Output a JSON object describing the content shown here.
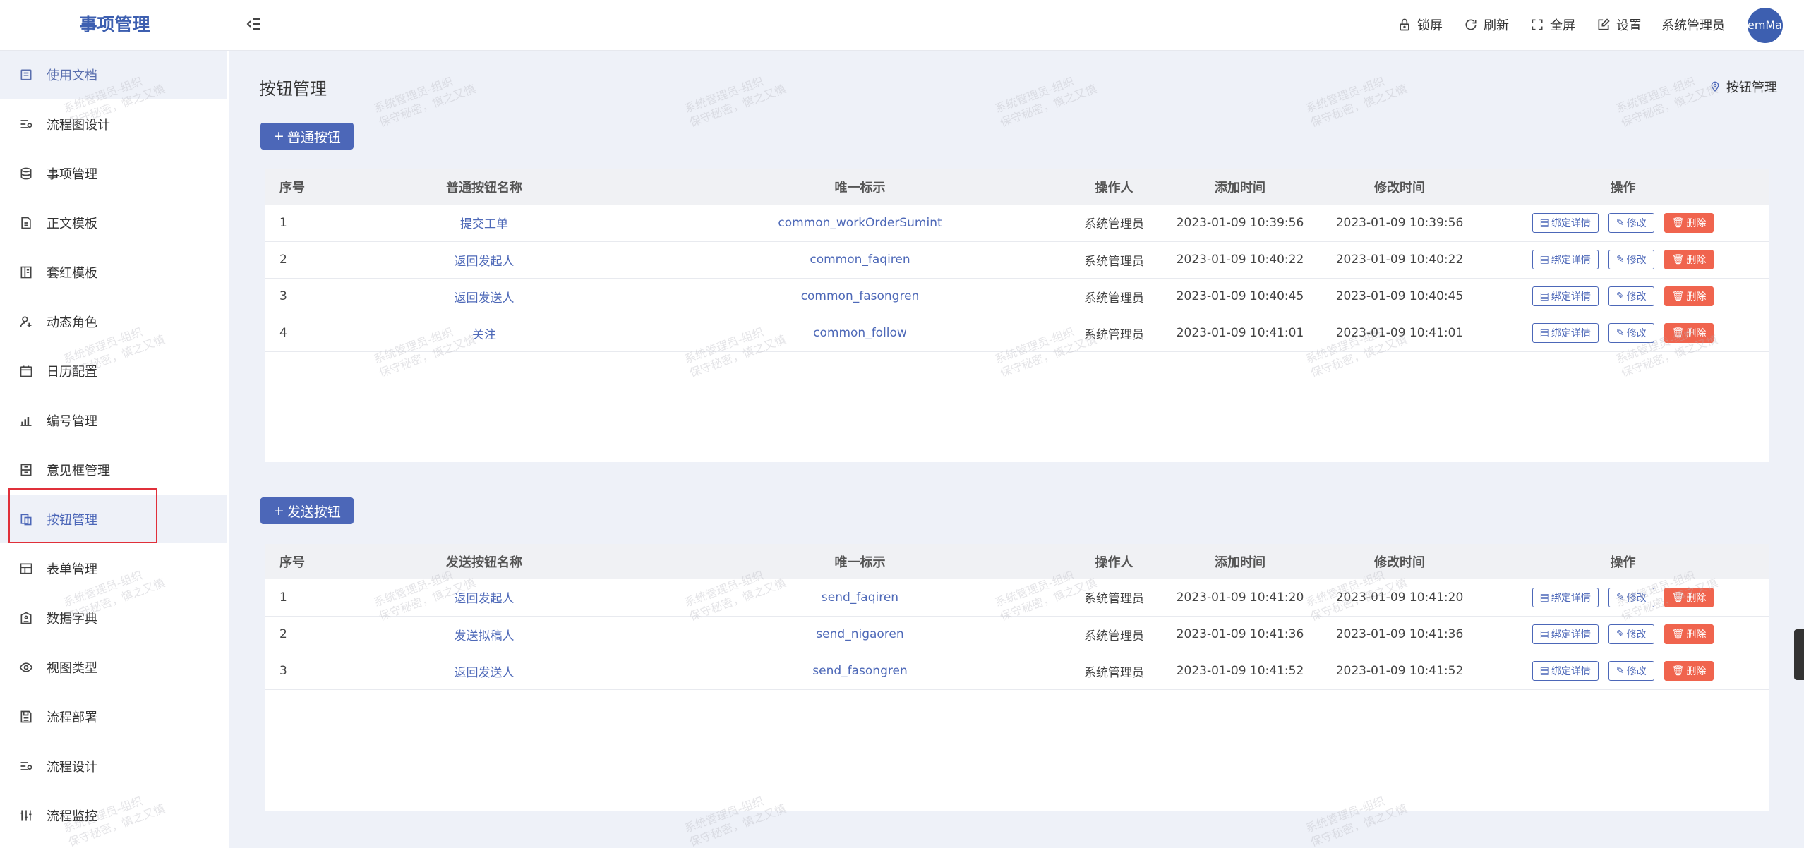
{
  "header": {
    "app_title": "事项管理",
    "lock": "锁屏",
    "refresh": "刷新",
    "fullscreen": "全屏",
    "settings": "设置",
    "user": "系统管理员",
    "avatar_text": "emMan"
  },
  "sidebar": {
    "items": [
      {
        "label": "使用文档",
        "icon": "document-icon"
      },
      {
        "label": "流程图设计",
        "icon": "flow-design-icon"
      },
      {
        "label": "事项管理",
        "icon": "database-icon"
      },
      {
        "label": "正文模板",
        "icon": "template-icon"
      },
      {
        "label": "套红模板",
        "icon": "red-template-icon"
      },
      {
        "label": "动态角色",
        "icon": "user-add-icon"
      },
      {
        "label": "日历配置",
        "icon": "calendar-icon"
      },
      {
        "label": "编号管理",
        "icon": "bar-chart-icon"
      },
      {
        "label": "意见框管理",
        "icon": "form-box-icon"
      },
      {
        "label": "按钮管理",
        "icon": "copy-icon"
      },
      {
        "label": "表单管理",
        "icon": "table-icon"
      },
      {
        "label": "数据字典",
        "icon": "dictionary-icon"
      },
      {
        "label": "视图类型",
        "icon": "eye-icon"
      },
      {
        "label": "流程部署",
        "icon": "save-icon"
      },
      {
        "label": "流程设计",
        "icon": "flow-icon"
      },
      {
        "label": "流程监控",
        "icon": "sliders-icon"
      }
    ]
  },
  "main": {
    "page_title": "按钮管理",
    "breadcrumb": "按钮管理",
    "common_add_label": "普通按钮",
    "send_add_label": "发送按钮",
    "common_table": {
      "headers": [
        "序号",
        "普通按钮名称",
        "唯一标示",
        "操作人",
        "添加时间",
        "修改时间",
        "操作"
      ],
      "rows": [
        {
          "idx": "1",
          "name": "提交工单",
          "key": "common_workOrderSumint",
          "operator": "系统管理员",
          "added": "2023-01-09 10:39:56",
          "modified": "2023-01-09 10:39:56"
        },
        {
          "idx": "2",
          "name": "返回发起人",
          "key": "common_faqiren",
          "operator": "系统管理员",
          "added": "2023-01-09 10:40:22",
          "modified": "2023-01-09 10:40:22"
        },
        {
          "idx": "3",
          "name": "返回发送人",
          "key": "common_fasongren",
          "operator": "系统管理员",
          "added": "2023-01-09 10:40:45",
          "modified": "2023-01-09 10:40:45"
        },
        {
          "idx": "4",
          "name": "关注",
          "key": "common_follow",
          "operator": "系统管理员",
          "added": "2023-01-09 10:41:01",
          "modified": "2023-01-09 10:41:01"
        }
      ]
    },
    "send_table": {
      "headers": [
        "序号",
        "发送按钮名称",
        "唯一标示",
        "操作人",
        "添加时间",
        "修改时间",
        "操作"
      ],
      "rows": [
        {
          "idx": "1",
          "name": "返回发起人",
          "key": "send_faqiren",
          "operator": "系统管理员",
          "added": "2023-01-09 10:41:20",
          "modified": "2023-01-09 10:41:20"
        },
        {
          "idx": "2",
          "name": "发送拟稿人",
          "key": "send_nigaoren",
          "operator": "系统管理员",
          "added": "2023-01-09 10:41:36",
          "modified": "2023-01-09 10:41:36"
        },
        {
          "idx": "3",
          "name": "返回发送人",
          "key": "send_fasongren",
          "operator": "系统管理员",
          "added": "2023-01-09 10:41:52",
          "modified": "2023-01-09 10:41:52"
        }
      ]
    },
    "row_actions": {
      "bind": "绑定详情",
      "edit": "修改",
      "delete": "删除"
    }
  },
  "watermark": {
    "line1": "系统管理员-组织",
    "line2": "保守秘密，慎之又慎"
  },
  "colors": {
    "accent": "#4c67b8",
    "danger": "#f0644e",
    "highlight": "#e0303a"
  }
}
